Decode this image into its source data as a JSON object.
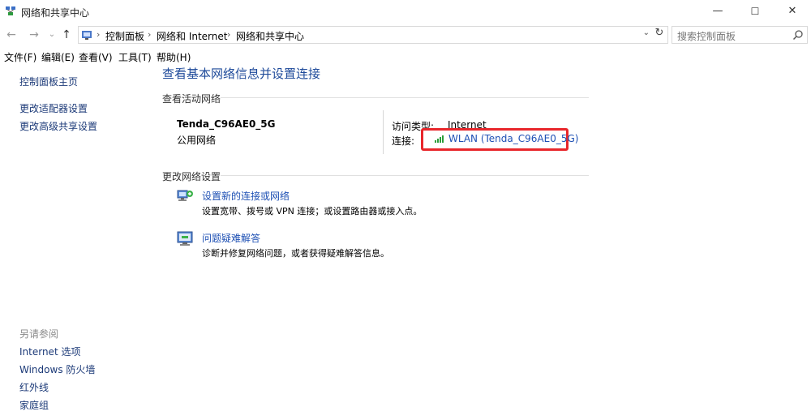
{
  "window": {
    "title": "网络和共享中心",
    "minimize": "—",
    "maximize": "☐",
    "close": "✕"
  },
  "nav": {
    "back": "←",
    "forward": "→",
    "recent": "⌄",
    "up": "↑"
  },
  "address": {
    "crumbs": [
      "控制面板",
      "网络和 Internet",
      "网络和共享中心"
    ],
    "separator": "›",
    "dropdown": "⌄",
    "refresh": "↻"
  },
  "search": {
    "placeholder": "搜索控制面板"
  },
  "menu": [
    "文件(F)",
    "编辑(E)",
    "查看(V)",
    "工具(T)",
    "帮助(H)"
  ],
  "sidebar": {
    "home": "控制面板主页",
    "links": [
      "更改适配器设置",
      "更改高级共享设置"
    ],
    "see_also_title": "另请参阅",
    "see_also": [
      "Internet 选项",
      "Windows 防火墙",
      "红外线",
      "家庭组"
    ]
  },
  "main": {
    "title": "查看基本网络信息并设置连接",
    "active_section": "查看活动网络",
    "network_name": "Tenda_C96AE0_5G",
    "network_category": "公用网络",
    "access_type_label": "访问类型:",
    "access_type_value": "Internet",
    "connection_label": "连接:",
    "connection_value": "WLAN (Tenda_C96AE0_5G)",
    "change_section": "更改网络设置",
    "tasks": [
      {
        "title": "设置新的连接或网络",
        "desc": "设置宽带、拨号或 VPN 连接；或设置路由器或接入点。"
      },
      {
        "title": "问题疑难解答",
        "desc": "诊断并修复网络问题，或者获得疑难解答信息。"
      }
    ]
  },
  "colors": {
    "link": "#1e50b4",
    "highlight": "#e8262b"
  }
}
